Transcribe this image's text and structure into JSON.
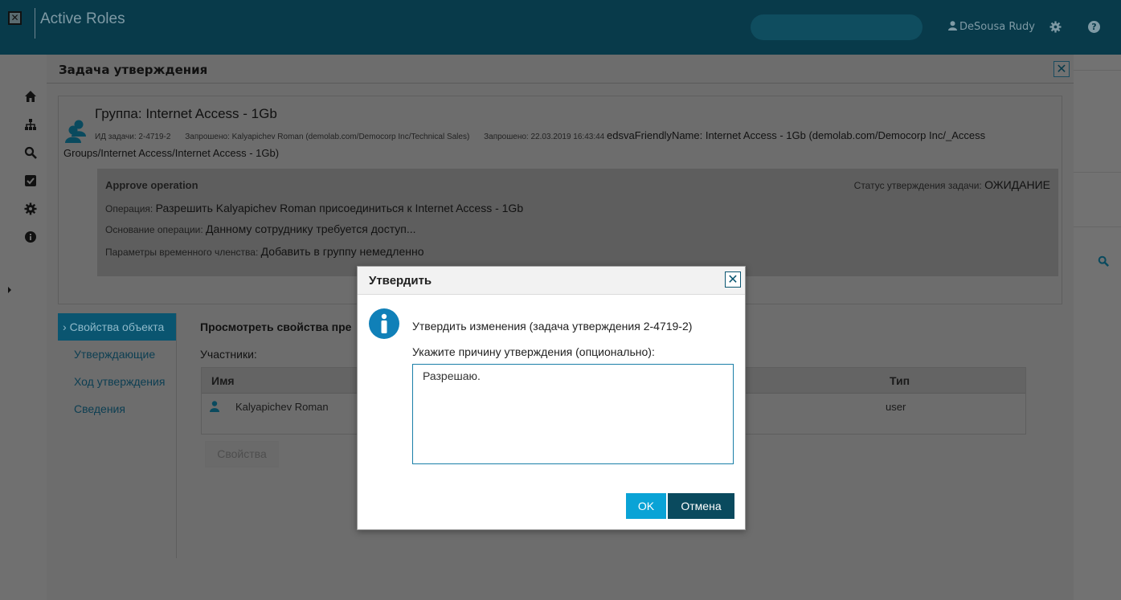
{
  "app": {
    "title": "Active Roles",
    "logo_glyph": "✕",
    "user_name": "DeSousa Rudy",
    "help_glyph": "?",
    "brand_color": "#083a4a"
  },
  "main_dialog": {
    "title": "Задача утверждения",
    "close_glyph": "✕",
    "group_title": "Группа: Internet Access - 1Gb",
    "task_id_label": "ИД задачи:",
    "task_id": "2-4719-2",
    "requested_by_label": "Запрошено:",
    "requested_by": "Kalyapichev Roman (demolab.com/Democorp Inc/Technical Sales)",
    "requested_at_label": "Запрошено:",
    "requested_at": "22.03.2019 16:43:44",
    "friendly_name_line1": "edsvaFriendlyName: Internet Access - 1Gb (demolab.com/Democorp Inc/_Access",
    "friendly_name_line2": "Groups/Internet Access/Internet Access - 1Gb)",
    "operation": {
      "title": "Approve operation",
      "status_label": "Статус утверждения задачи:",
      "status_value": "ОЖИДАНИЕ",
      "op_label": "Операция:",
      "op_value": "Разрешить Kalyapichev Roman присоединиться к Internet Access - 1Gb",
      "reason_label": "Основание операции:",
      "reason_value": "Данному сотруднику требуется доступ...",
      "temp_label": "Параметры временного членства:",
      "temp_value": "Добавить в группу немедленно"
    },
    "tabs": [
      {
        "label": "Свойства объекта",
        "active": true
      },
      {
        "label": "Утверждающие"
      },
      {
        "label": "Ход утверждения"
      },
      {
        "label": "Сведения"
      }
    ],
    "active_tab_chevron": "›",
    "content_title": "Просмотреть свойства пре",
    "members_label": "Участники:",
    "table": {
      "headers": {
        "name": "Имя",
        "type": "Тип"
      },
      "rows": [
        {
          "name": "Kalyapichev Roman",
          "type": "user"
        }
      ]
    },
    "properties_button": "Свойства"
  },
  "modal": {
    "title": "Утвердить",
    "close_glyph": "✕",
    "message": "Утвердить изменения (задача утверждения 2-4719-2)",
    "prompt": "Укажите причину утверждения (опционально):",
    "reason_value": "Разрешаю.",
    "ok_label": "OK",
    "cancel_label": "Отмена",
    "ok_color": "#0aa3d6",
    "cancel_color": "#0a4a5e"
  }
}
